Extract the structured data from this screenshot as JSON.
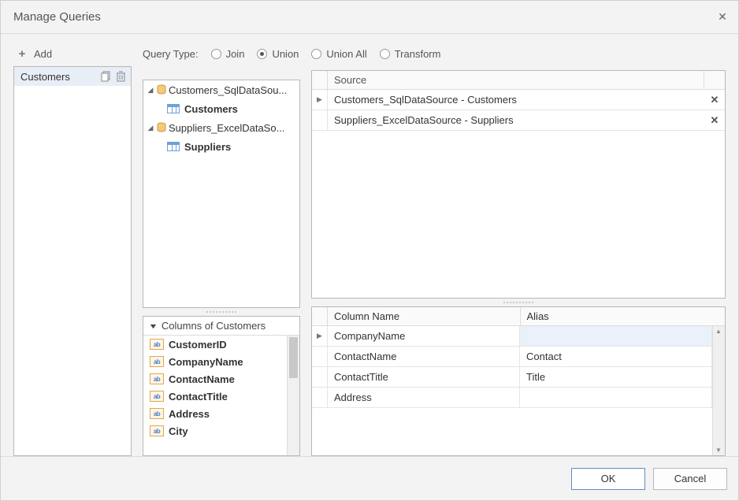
{
  "dialog_title": "Manage Queries",
  "add_label": "Add",
  "queries": {
    "items": [
      {
        "name": "Customers"
      }
    ]
  },
  "query_type": {
    "label": "Query Type:",
    "options": [
      {
        "label": "Join",
        "selected": false
      },
      {
        "label": "Union",
        "selected": true
      },
      {
        "label": "Union All",
        "selected": false
      },
      {
        "label": "Transform",
        "selected": false
      }
    ]
  },
  "tree": {
    "nodes": [
      {
        "label": "Customers_SqlDataSou...",
        "children": [
          {
            "label": "Customers"
          }
        ]
      },
      {
        "label": "Suppliers_ExcelDataSo...",
        "children": [
          {
            "label": "Suppliers"
          }
        ]
      }
    ]
  },
  "columns_panel": {
    "header": "Columns of Customers",
    "items": [
      {
        "name": "CustomerID"
      },
      {
        "name": "CompanyName"
      },
      {
        "name": "ContactName"
      },
      {
        "name": "ContactTitle"
      },
      {
        "name": "Address"
      },
      {
        "name": "City"
      }
    ]
  },
  "source_grid": {
    "header": "Source",
    "rows": [
      {
        "text": "Customers_SqlDataSource - Customers",
        "active": true
      },
      {
        "text": "Suppliers_ExcelDataSource - Suppliers",
        "active": false
      }
    ]
  },
  "result_grid": {
    "col_name_header": "Column Name",
    "alias_header": "Alias",
    "rows": [
      {
        "name": "CompanyName",
        "alias": "",
        "active": true
      },
      {
        "name": "ContactName",
        "alias": "Contact",
        "active": false
      },
      {
        "name": "ContactTitle",
        "alias": "Title",
        "active": false
      },
      {
        "name": "Address",
        "alias": "",
        "active": false
      }
    ]
  },
  "buttons": {
    "ok": "OK",
    "cancel": "Cancel"
  }
}
